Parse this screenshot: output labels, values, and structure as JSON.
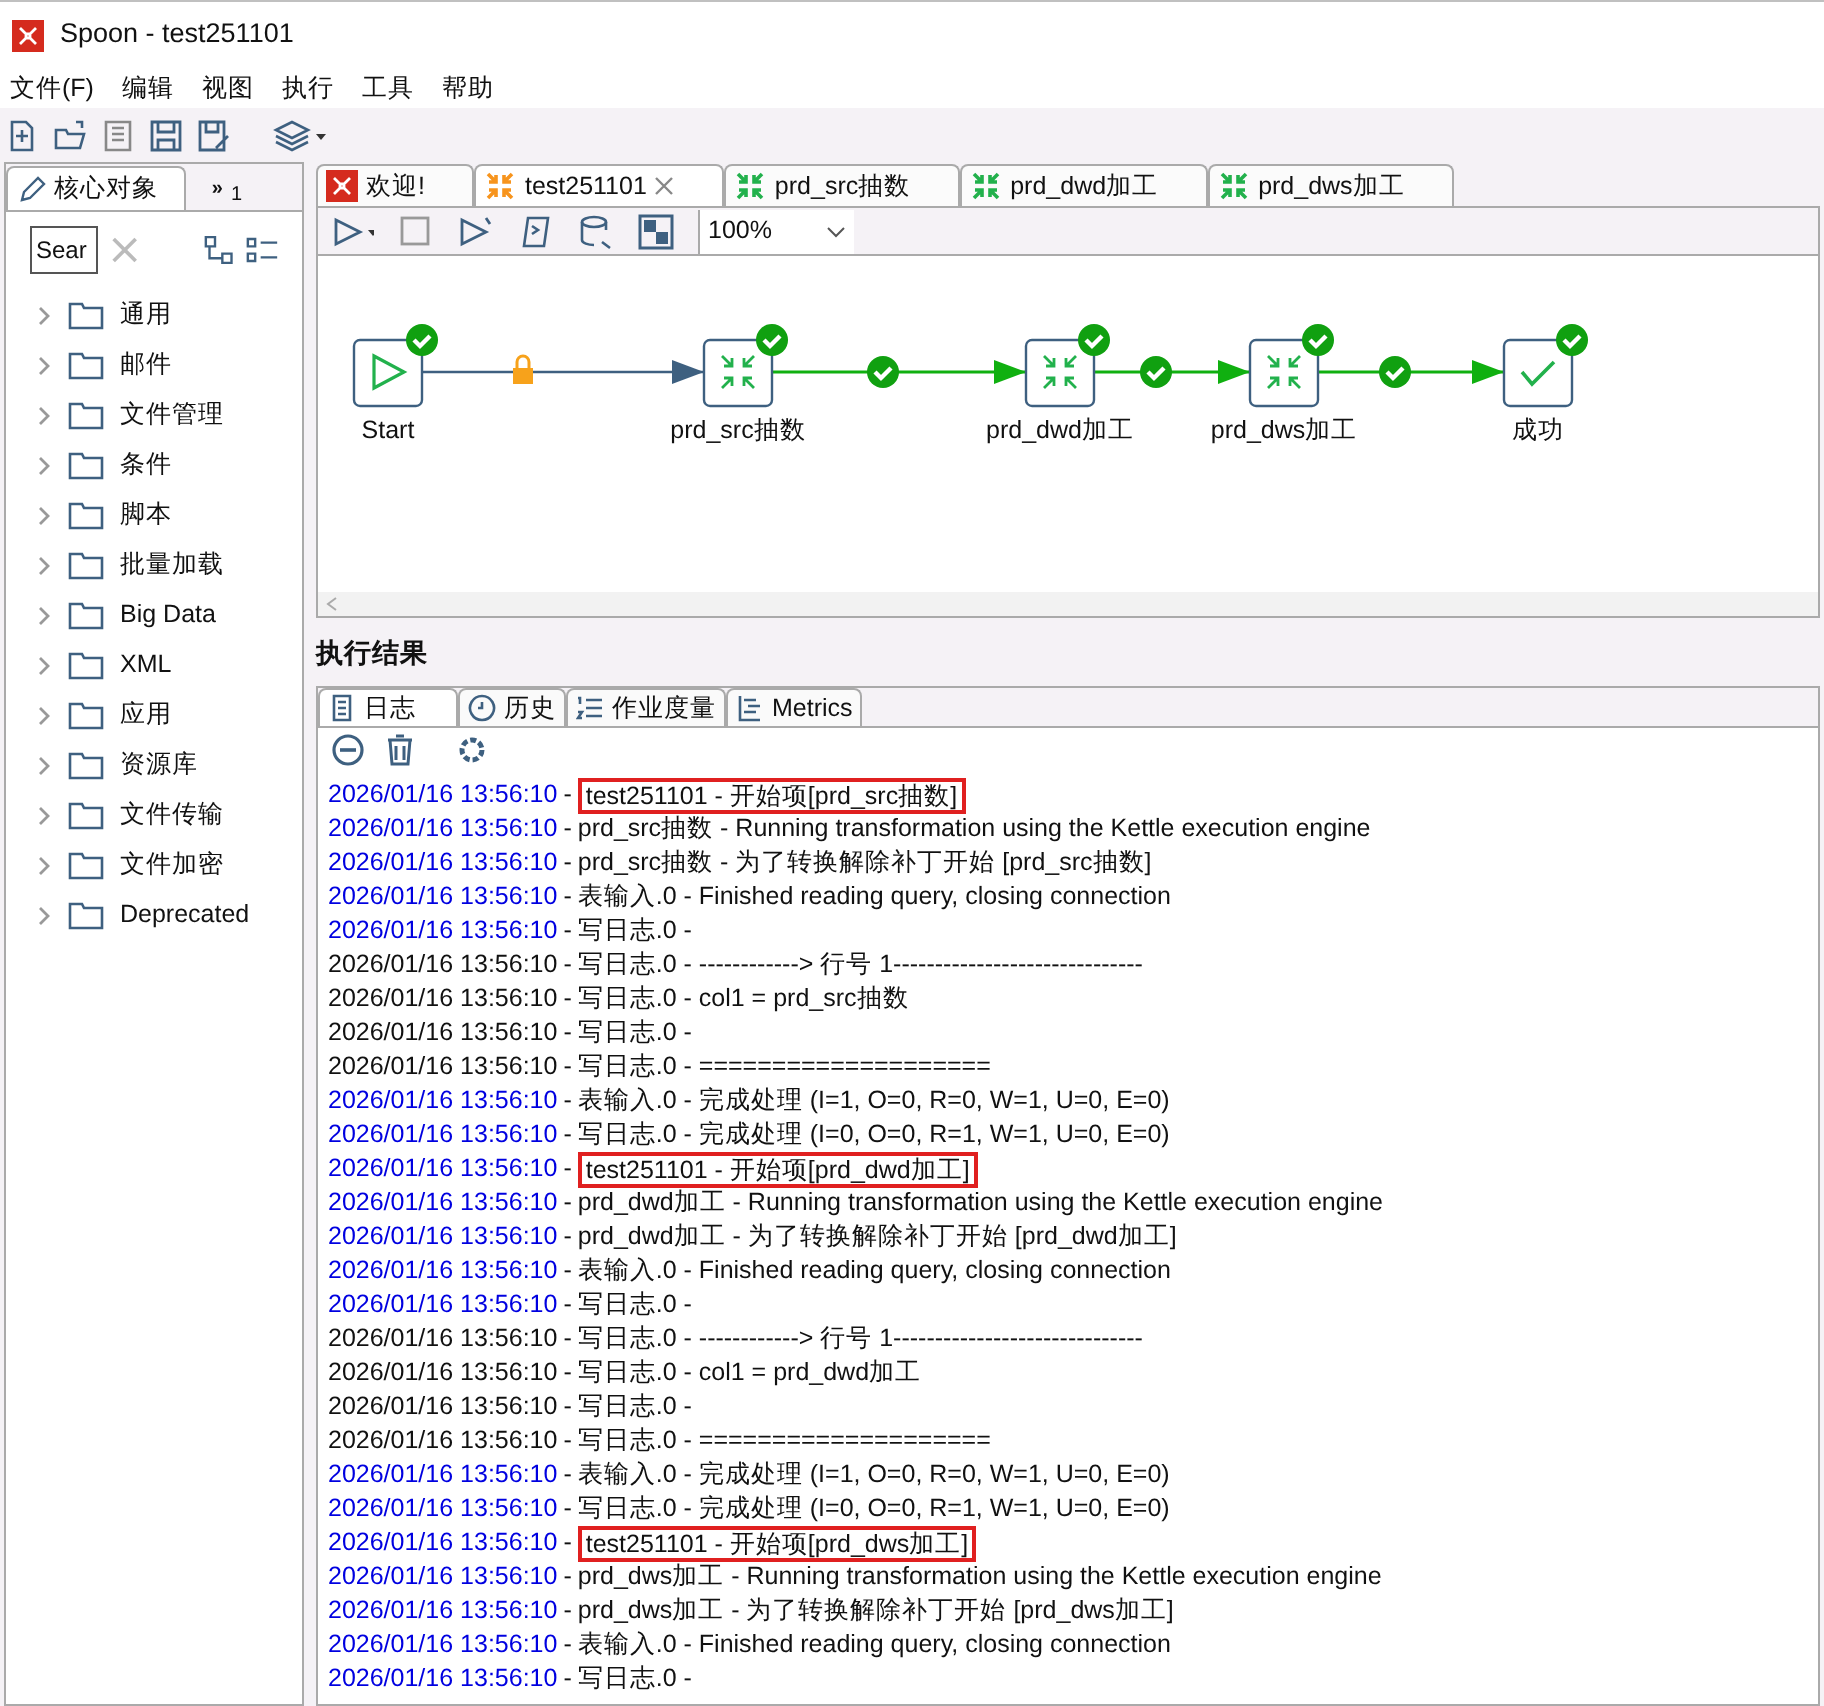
{
  "window": {
    "title": "Spoon - test251101"
  },
  "menu": [
    "文件(F)",
    "编辑",
    "视图",
    "执行",
    "工具",
    "帮助"
  ],
  "left_panel": {
    "tabs": [
      {
        "label": "核心对象",
        "selected": true
      },
      {
        "icon": "»",
        "label": "1",
        "selected": false
      }
    ],
    "search": {
      "value": "Sear"
    },
    "items": [
      {
        "label": "通用",
        "expanded": false
      },
      {
        "label": "邮件",
        "expanded": false
      },
      {
        "label": "文件管理",
        "expanded": false
      },
      {
        "label": "条件",
        "expanded": false
      },
      {
        "label": "脚本",
        "expanded": false
      },
      {
        "label": "批量加载",
        "expanded": false
      },
      {
        "label": "Big Data",
        "expanded": false
      },
      {
        "label": "XML",
        "expanded": false
      },
      {
        "label": "应用",
        "expanded": false
      },
      {
        "label": "资源库",
        "expanded": false
      },
      {
        "label": "文件传输",
        "expanded": false
      },
      {
        "label": "文件加密",
        "expanded": false
      },
      {
        "label": "Deprecated",
        "expanded": false
      }
    ]
  },
  "editor_tabs": [
    {
      "label": "欢迎!",
      "kind": "welcome",
      "selected": false
    },
    {
      "label": "test251101",
      "kind": "job",
      "selected": true
    },
    {
      "label": "prd_src抽数",
      "kind": "trans",
      "selected": false
    },
    {
      "label": "prd_dwd加工",
      "kind": "trans",
      "selected": false
    },
    {
      "label": "prd_dws加工",
      "kind": "trans",
      "selected": false
    }
  ],
  "zoom": {
    "value": "100%"
  },
  "diagram": {
    "nodes": [
      {
        "label": "Start",
        "kind": "start"
      },
      {
        "label": "prd_src抽数",
        "kind": "trans"
      },
      {
        "label": "prd_dwd加工",
        "kind": "trans"
      },
      {
        "label": "prd_dws加工",
        "kind": "trans"
      },
      {
        "label": "成功",
        "kind": "success"
      }
    ],
    "hops": [
      {
        "kind": "locked"
      },
      {
        "kind": "ok"
      },
      {
        "kind": "ok"
      },
      {
        "kind": "ok"
      }
    ]
  },
  "results": {
    "title": "执行结果",
    "tabs": [
      {
        "label": "日志",
        "selected": true
      },
      {
        "label": "历史",
        "selected": false
      },
      {
        "label": "作业度量",
        "selected": false
      },
      {
        "label": "Metrics",
        "selected": false
      }
    ],
    "log": [
      {
        "time": "2026/01/16 13:56:10",
        "separator": "-",
        "message": "test251101 - 开始项[prd_src抽数]",
        "kind": "blue",
        "highlighted": true
      },
      {
        "time": "2026/01/16 13:56:10",
        "separator": "-",
        "message": "prd_src抽数 - Running transformation using the Kettle execution engine",
        "kind": "blue",
        "highlighted": false
      },
      {
        "time": "2026/01/16 13:56:10",
        "separator": "-",
        "message": "prd_src抽数 - 为了转换解除补丁开始  [prd_src抽数]",
        "kind": "blue",
        "highlighted": false
      },
      {
        "time": "2026/01/16 13:56:10",
        "separator": "-",
        "message": "表输入.0 - Finished reading query, closing connection",
        "kind": "blue",
        "highlighted": false
      },
      {
        "time": "2026/01/16 13:56:10",
        "separator": "-",
        "message": "写日志.0 -",
        "kind": "blue",
        "highlighted": false
      },
      {
        "time": "2026/01/16 13:56:10",
        "separator": "-",
        "message": "写日志.0 - ------------> 行号 1------------------------------",
        "kind": "black",
        "highlighted": false
      },
      {
        "time": "2026/01/16 13:56:10",
        "separator": "-",
        "message": "写日志.0 - col1 = prd_src抽数",
        "kind": "black",
        "highlighted": false
      },
      {
        "time": "2026/01/16 13:56:10",
        "separator": "-",
        "message": "写日志.0 -",
        "kind": "black",
        "highlighted": false
      },
      {
        "time": "2026/01/16 13:56:10",
        "separator": "-",
        "message": "写日志.0 - ====================",
        "kind": "black",
        "highlighted": false
      },
      {
        "time": "2026/01/16 13:56:10",
        "separator": "-",
        "message": "表输入.0 - 完成处理 (I=1, O=0, R=0, W=1, U=0, E=0)",
        "kind": "blue",
        "highlighted": false
      },
      {
        "time": "2026/01/16 13:56:10",
        "separator": "-",
        "message": "写日志.0 - 完成处理 (I=0, O=0, R=1, W=1, U=0, E=0)",
        "kind": "blue",
        "highlighted": false
      },
      {
        "time": "2026/01/16 13:56:10",
        "separator": "-",
        "message": "test251101 - 开始项[prd_dwd加工]",
        "kind": "blue",
        "highlighted": true
      },
      {
        "time": "2026/01/16 13:56:10",
        "separator": "-",
        "message": "prd_dwd加工 - Running transformation using the Kettle execution engine",
        "kind": "blue",
        "highlighted": false
      },
      {
        "time": "2026/01/16 13:56:10",
        "separator": "-",
        "message": "prd_dwd加工 - 为了转换解除补丁开始  [prd_dwd加工]",
        "kind": "blue",
        "highlighted": false
      },
      {
        "time": "2026/01/16 13:56:10",
        "separator": "-",
        "message": "表输入.0 - Finished reading query, closing connection",
        "kind": "blue",
        "highlighted": false
      },
      {
        "time": "2026/01/16 13:56:10",
        "separator": "-",
        "message": "写日志.0 -",
        "kind": "blue",
        "highlighted": false
      },
      {
        "time": "2026/01/16 13:56:10",
        "separator": "-",
        "message": "写日志.0 - ------------> 行号 1------------------------------",
        "kind": "black",
        "highlighted": false
      },
      {
        "time": "2026/01/16 13:56:10",
        "separator": "-",
        "message": "写日志.0 - col1 = prd_dwd加工",
        "kind": "black",
        "highlighted": false
      },
      {
        "time": "2026/01/16 13:56:10",
        "separator": "-",
        "message": "写日志.0 -",
        "kind": "black",
        "highlighted": false
      },
      {
        "time": "2026/01/16 13:56:10",
        "separator": "-",
        "message": "写日志.0 - ====================",
        "kind": "black",
        "highlighted": false
      },
      {
        "time": "2026/01/16 13:56:10",
        "separator": "-",
        "message": "表输入.0 - 完成处理 (I=1, O=0, R=0, W=1, U=0, E=0)",
        "kind": "blue",
        "highlighted": false
      },
      {
        "time": "2026/01/16 13:56:10",
        "separator": "-",
        "message": "写日志.0 - 完成处理 (I=0, O=0, R=1, W=1, U=0, E=0)",
        "kind": "blue",
        "highlighted": false
      },
      {
        "time": "2026/01/16 13:56:10",
        "separator": "-",
        "message": "test251101 - 开始项[prd_dws加工]",
        "kind": "blue",
        "highlighted": true
      },
      {
        "time": "2026/01/16 13:56:10",
        "separator": "-",
        "message": "prd_dws加工 - Running transformation using the Kettle execution engine",
        "kind": "blue",
        "highlighted": false
      },
      {
        "time": "2026/01/16 13:56:10",
        "separator": "-",
        "message": "prd_dws加工 - 为了转换解除补丁开始  [prd_dws加工]",
        "kind": "blue",
        "highlighted": false
      },
      {
        "time": "2026/01/16 13:56:10",
        "separator": "-",
        "message": "表输入.0 - Finished reading query, closing connection",
        "kind": "blue",
        "highlighted": false
      },
      {
        "time": "2026/01/16 13:56:10",
        "separator": "-",
        "message": "写日志.0 -",
        "kind": "blue",
        "highlighted": false
      }
    ]
  }
}
